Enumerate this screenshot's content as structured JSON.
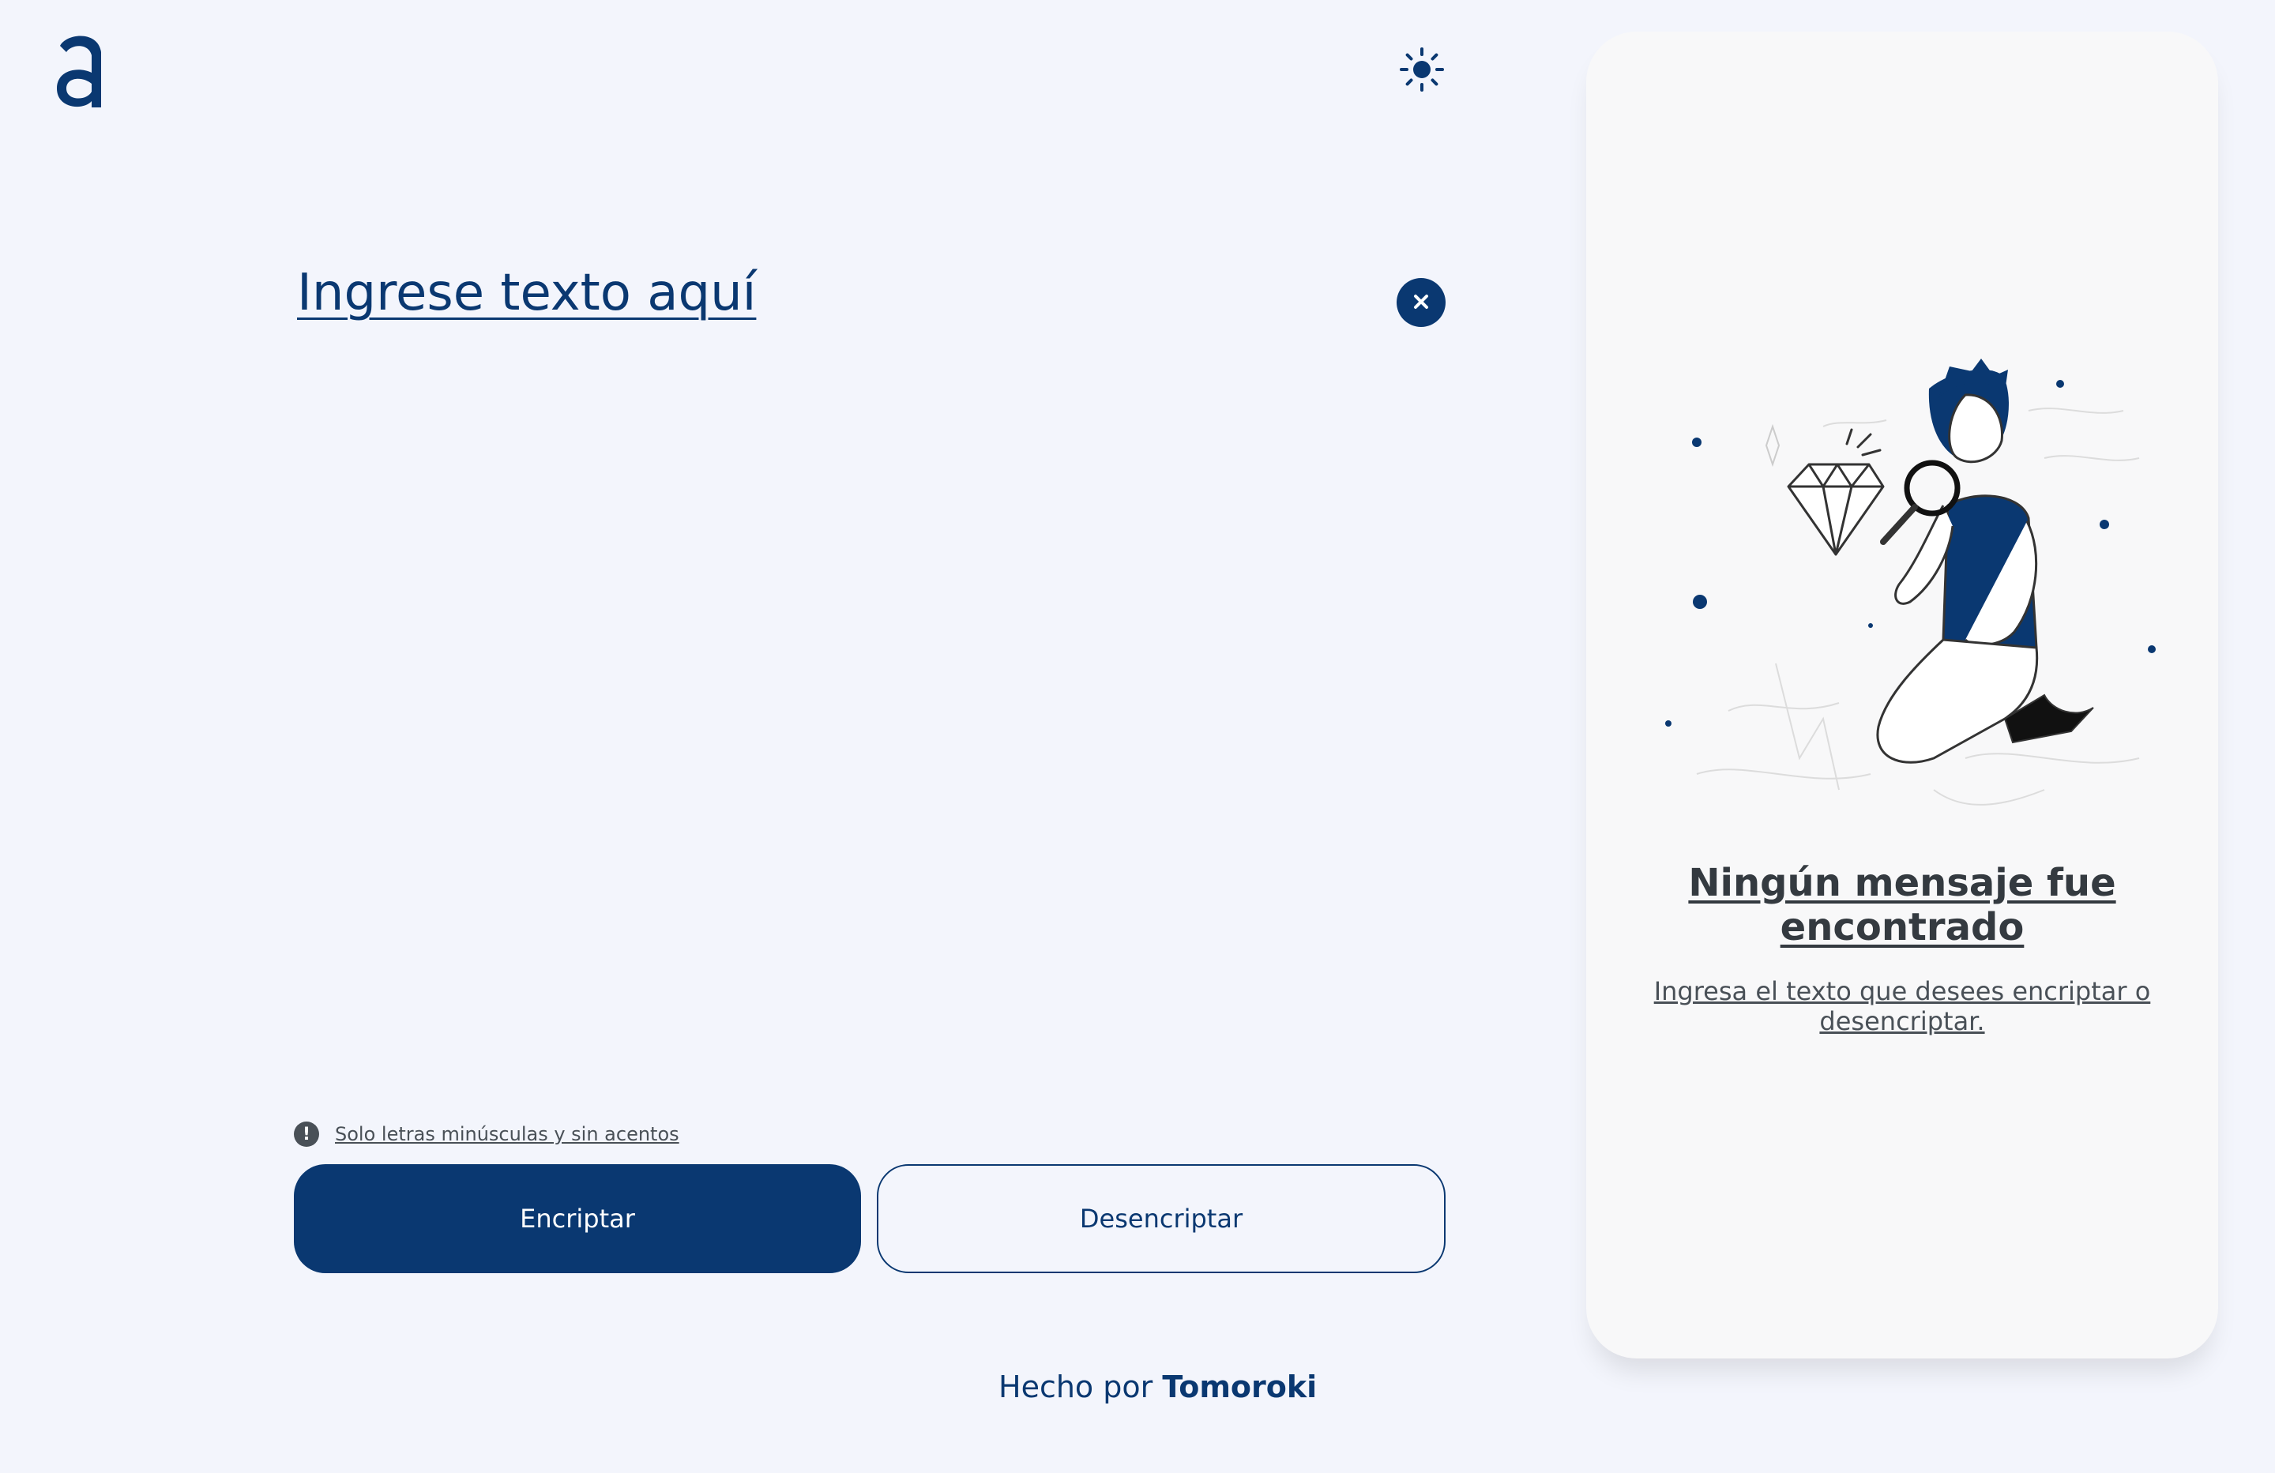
{
  "header": {
    "logo_icon": "alura-logo-icon",
    "theme_icon": "sun-icon"
  },
  "input": {
    "placeholder": "Ingrese texto aquí",
    "value": "",
    "clear_icon": "close-icon"
  },
  "hint": {
    "icon": "exclamation-icon",
    "text": "Solo letras minúsculas y sin acentos"
  },
  "actions": {
    "encrypt_label": "Encriptar",
    "decrypt_label": "Desencriptar"
  },
  "footer": {
    "prefix": "Hecho por ",
    "author": "Tomoroki"
  },
  "output": {
    "illustration_icon": "person-with-magnifier-illustration",
    "title": "Ningún mensaje fue encontrado",
    "description": "Ingresa el texto que desees encriptar o desencriptar."
  },
  "colors": {
    "background": "#f3f5fc",
    "primary": "#0a3871",
    "panel": "#f8f8f9",
    "muted": "#495057",
    "title": "#343a40"
  }
}
